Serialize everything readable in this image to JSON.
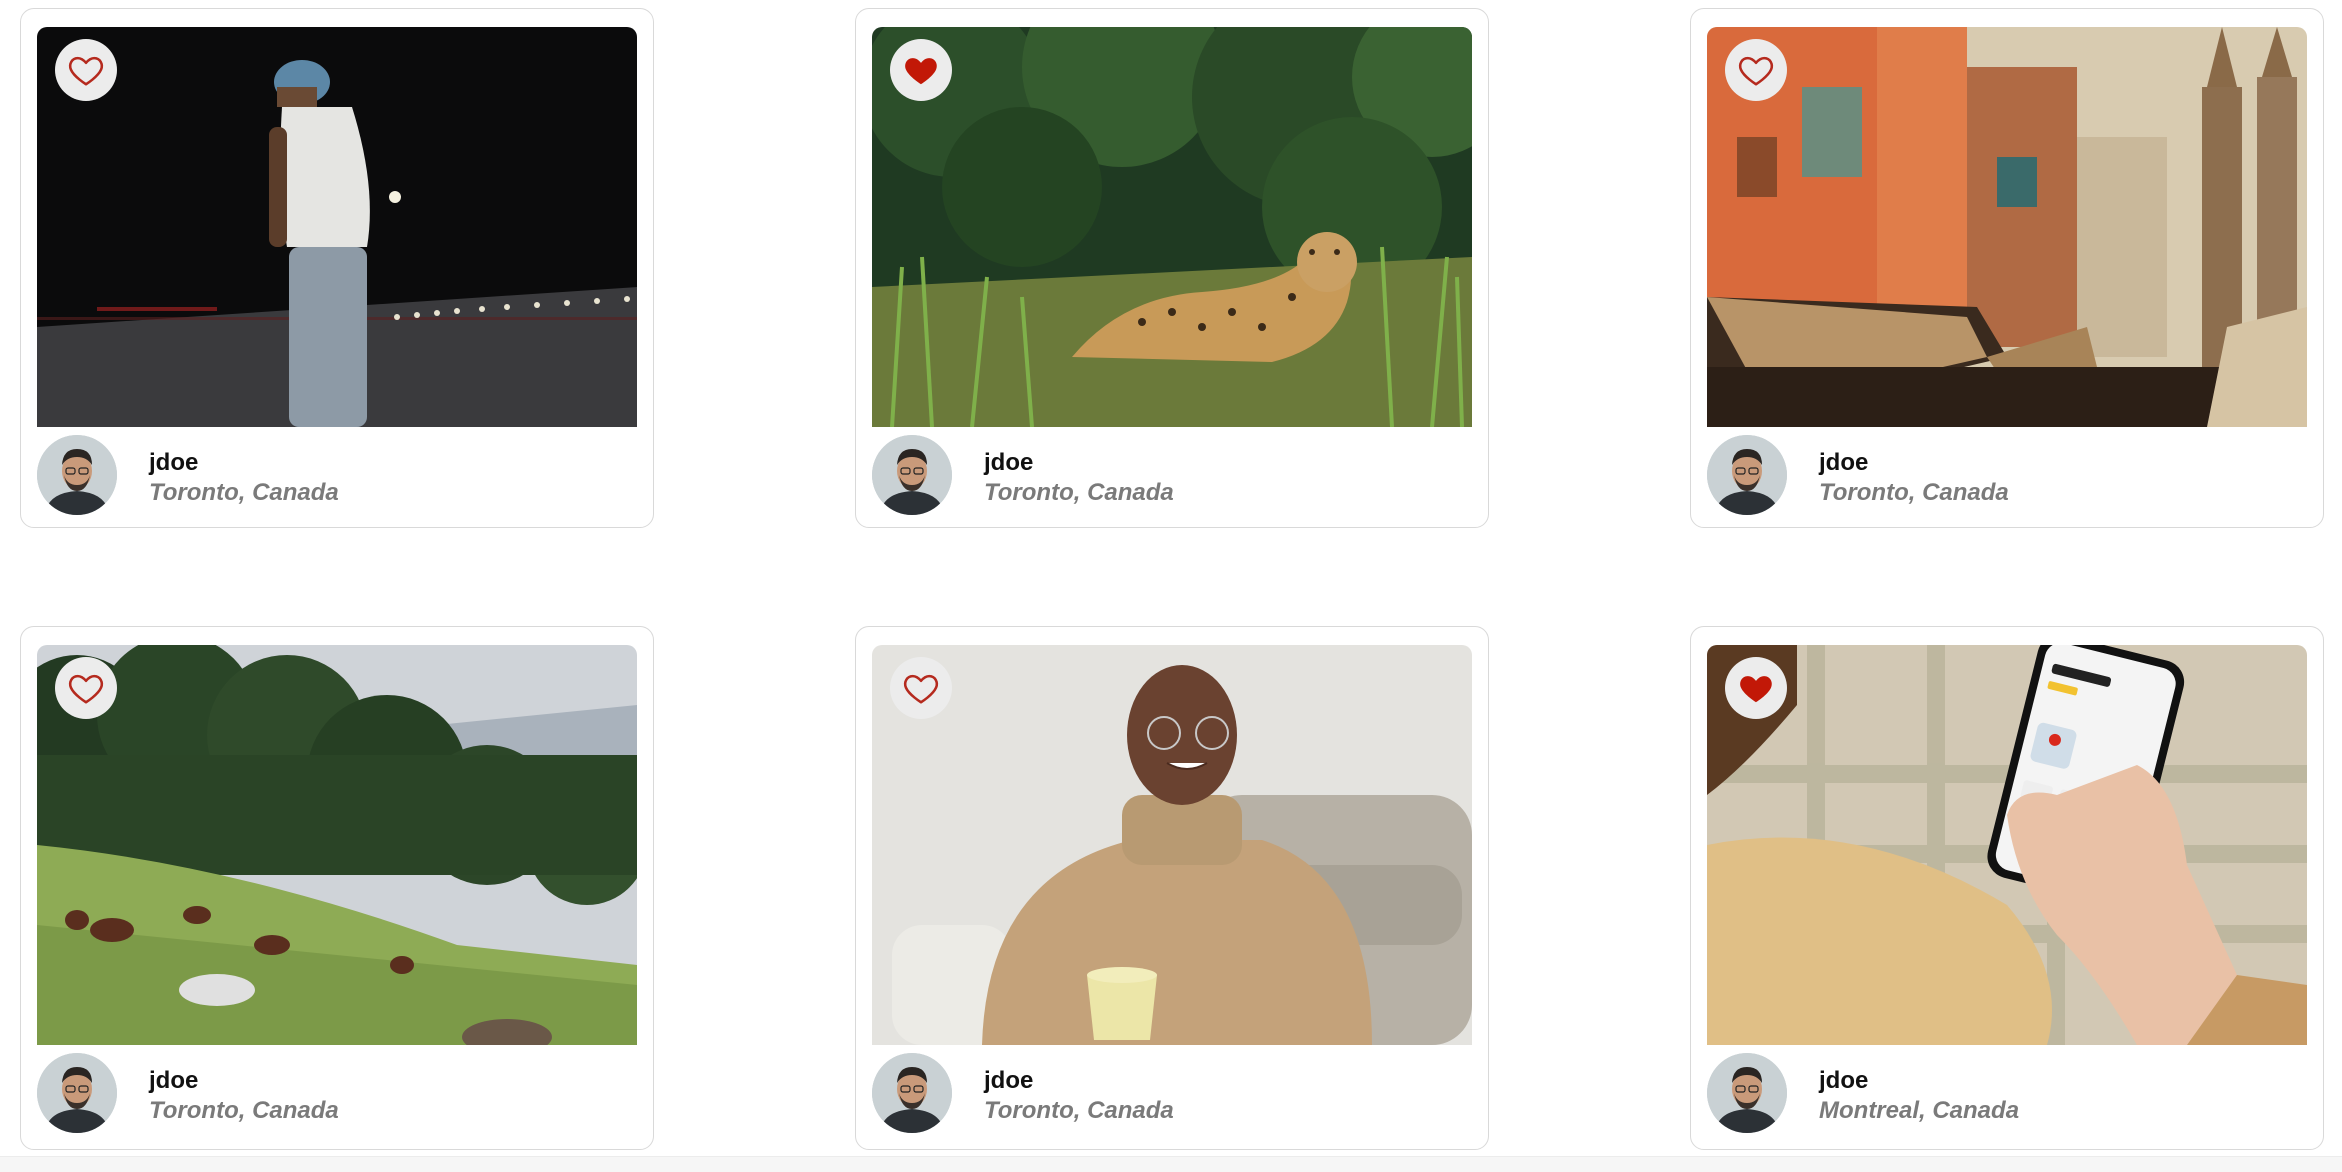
{
  "colors": {
    "like_active": "#c21807",
    "like_inactive": "#b52a1e",
    "like_button_bg": "#ececec",
    "card_border": "#d9d9d9",
    "username": "#111111",
    "location": "#7a7a7a"
  },
  "posts": [
    {
      "username": "jdoe",
      "location": "Toronto, Canada",
      "liked": false,
      "photo": "man-walking-night-road"
    },
    {
      "username": "jdoe",
      "location": "Toronto, Canada",
      "liked": true,
      "photo": "jaguar-resting-in-grass"
    },
    {
      "username": "jdoe",
      "location": "Toronto, Canada",
      "liked": false,
      "photo": "old-town-street-buildings-temple-spires"
    },
    {
      "username": "jdoe",
      "location": "Toronto, Canada",
      "liked": false,
      "photo": "horses-grazing-hillside-forest"
    },
    {
      "username": "jdoe",
      "location": "Toronto, Canada",
      "liked": false,
      "photo": "smiling-man-turtleneck-holding-mug"
    },
    {
      "username": "jdoe",
      "location": "Montreal, Canada",
      "liked": true,
      "photo": "hand-holding-phone-starbucks-app"
    }
  ]
}
